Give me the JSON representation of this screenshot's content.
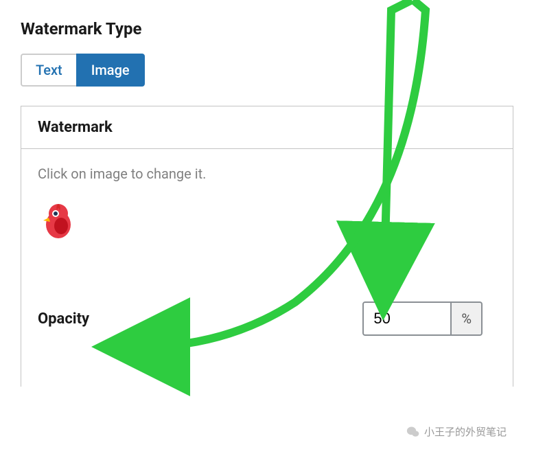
{
  "section": {
    "title": "Watermark Type"
  },
  "tabs": {
    "text_label": "Text",
    "image_label": "Image"
  },
  "panel": {
    "header": "Watermark",
    "help_text": "Click on image to change it.",
    "opacity_label": "Opacity",
    "opacity_value": "50",
    "opacity_suffix": "%"
  },
  "credit": {
    "text": "小王子的外贸笔记"
  },
  "annotation": {
    "color": "#2ECC40"
  }
}
